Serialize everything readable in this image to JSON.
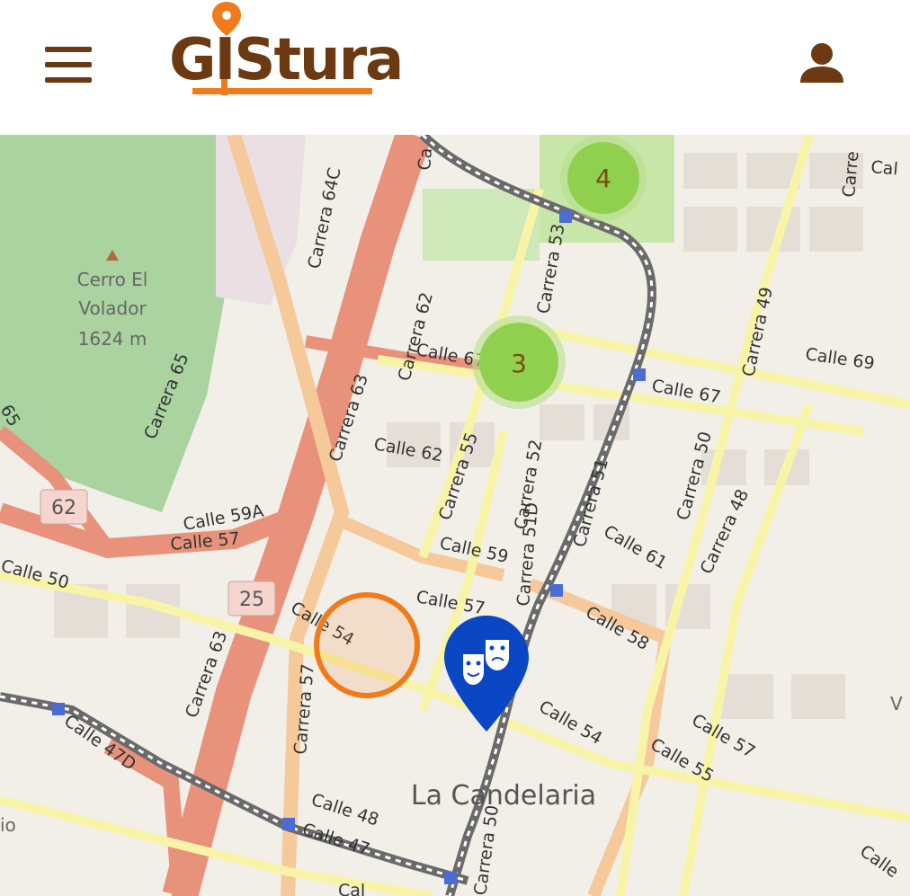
{
  "header": {
    "menu_icon": "hamburger-icon",
    "logo_text": "GIStura",
    "logo_pin_icon": "location-pin-icon",
    "user_icon": "user-icon",
    "brand_color": "#6b3a12",
    "accent_color": "#f07b1a"
  },
  "map": {
    "clusters": [
      {
        "count": "4",
        "color": "#8fd14f"
      },
      {
        "count": "3",
        "color": "#8fd14f"
      }
    ],
    "poi_marker": {
      "icon": "theater-masks-icon",
      "color": "#0b47c4"
    },
    "selection_circle_color": "#f07b1a",
    "hill": {
      "name": "Cerro El",
      "name2": "Volador",
      "elevation": "1624 m"
    },
    "district": "La Candelaria",
    "route_shields": [
      "62",
      "25"
    ],
    "streets": {
      "carrera_64c": "Carrera 64C",
      "carrera_62": "Carrera 62",
      "carrera_63_top": "Carrera 63",
      "carrera_65": "Carrera 65",
      "carrera_53": "Carrera 53",
      "carrera_55": "Carrera 55",
      "carrera_52": "Carrera 52",
      "carrera_51": "Carrera 51",
      "carrera_49": "Carrera 49",
      "carrera_50": "Carrera 50",
      "carrera_48": "Carrera 48",
      "carrera_63_bottom": "Carrera 63",
      "carrera_57": "Carrera 57",
      "carrera_51d": "Carrera 51D",
      "carrera_50_bottom": "Carrera 50",
      "calle_67_left": "Calle 67",
      "calle_67_right": "Calle 67",
      "calle_69": "Calle 69",
      "calle_62": "Calle 62",
      "calle_59a": "Calle 59A",
      "calle_57_left": "Calle 57",
      "calle_59": "Calle 59",
      "calle_61": "Calle 61",
      "calle_57_mid": "Calle 57",
      "calle_58": "Calle 58",
      "calle_50": "Calle 50",
      "calle_54_left": "Calle 54",
      "calle_54_right": "Calle 54",
      "calle_57_right": "Calle 57",
      "calle_55": "Calle 55",
      "calle_47d": "Calle 47D",
      "calle_48": "Calle 48",
      "calle_47": "Calle 47",
      "calle_top_right": "Cal",
      "calle_bottom_right": "Calle",
      "calle_bottom": "Cal",
      "calle_car_55": "Ca",
      "io": "io",
      "label_v": "V",
      "label_65": "65",
      "label_ca_top": "Ca",
      "label_carre_top": "Carre"
    }
  }
}
